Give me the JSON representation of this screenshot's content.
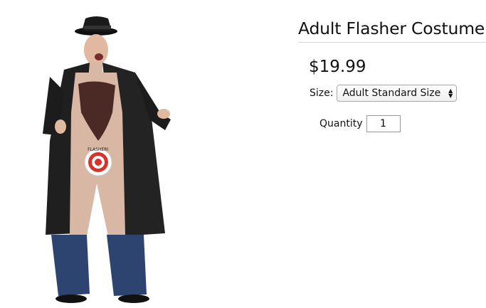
{
  "product": {
    "title": "Adult Flasher Costume",
    "price": "$19.99",
    "image_alt": "product-photo",
    "badge_text": "FLASHER!"
  },
  "options": {
    "size_label": "Size:",
    "size_selected": "Adult Standard Size",
    "quantity_label": "Quantity",
    "quantity_value": "1"
  },
  "icons": {
    "select_arrows": "up-down-chevron-icon"
  },
  "colors": {
    "coat": "#1f1f1f",
    "bodysuit": "#d8b8a4",
    "pants": "#2d4470",
    "target_red": "#d9312b"
  }
}
